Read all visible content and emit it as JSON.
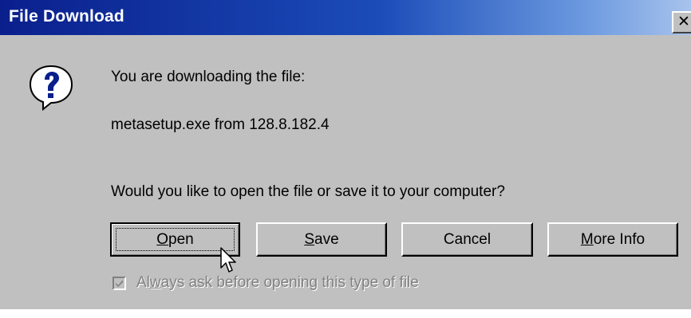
{
  "dialog": {
    "title": "File Download",
    "close_glyph": "✕",
    "icon": "question-icon",
    "message_line1": "You are downloading the file:",
    "message_line2": "metasetup.exe from 128.8.182.4",
    "prompt": "Would you like to open the file or save it to your computer?",
    "buttons": {
      "open": {
        "accel": "O",
        "rest": "pen"
      },
      "save": {
        "accel": "S",
        "rest": "ave"
      },
      "cancel": {
        "label": "Cancel"
      },
      "more_info": {
        "accel": "M",
        "rest": "ore Info"
      }
    },
    "checkbox": {
      "label_pre": "Al",
      "label_accel": "w",
      "label_post": "ays ask before opening this type of file",
      "checked": true,
      "disabled": true
    }
  },
  "colors": {
    "title_gradient_start": "#0a1f8c",
    "title_gradient_end": "#a8c3ec",
    "dialog_face": "#c0c0c0"
  }
}
